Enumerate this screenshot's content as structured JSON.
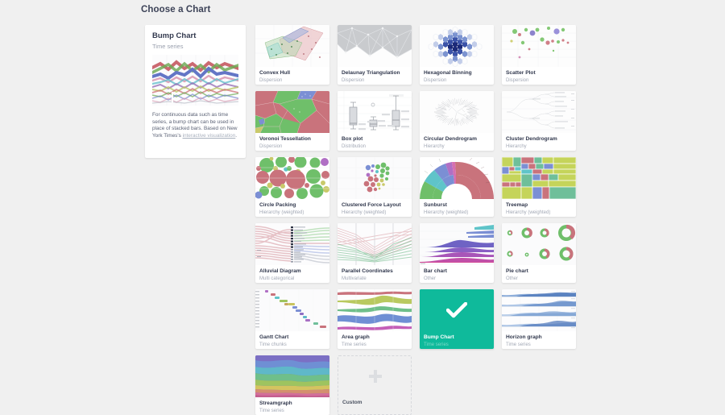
{
  "header": {
    "title": "Choose a Chart"
  },
  "detail": {
    "title": "Bump Chart",
    "subtitle": "Time series",
    "thumb_icon": "bump-chart-thumbnail",
    "description_pre": "For continuous data such as time series, a bump chart can be used in place of stacked bars. Based on New York Times's ",
    "description_link": "interactive visualization",
    "description_post": "."
  },
  "colors": {
    "page_background": "#f0f0f0",
    "card_background": "#ffffff",
    "title_text": "#32394e",
    "subtitle_text": "#a3a9b6",
    "selected_accent": "#0fba9b",
    "selected_subtitle": "#7fd9c9",
    "link": "#a8b0bd",
    "custom_border": "#d6d8dc"
  },
  "grid": {
    "cards": [
      {
        "title": "Convex Hull",
        "category": "Dispersion",
        "thumb": "convex-hull-thumbnail",
        "selected": false
      },
      {
        "title": "Delaunay Triangulation",
        "category": "Dispersion",
        "thumb": "delaunay-triangulation-thumbnail",
        "selected": false
      },
      {
        "title": "Hexagonal Binning",
        "category": "Dispersion",
        "thumb": "hexagonal-binning-thumbnail",
        "selected": false
      },
      {
        "title": "Scatter Plot",
        "category": "Dispersion",
        "thumb": "scatter-plot-thumbnail",
        "selected": false
      },
      {
        "title": "Voronoi Tessellation",
        "category": "Dispersion",
        "thumb": "voronoi-tessellation-thumbnail",
        "selected": false
      },
      {
        "title": "Box plot",
        "category": "Distribution",
        "thumb": "box-plot-thumbnail",
        "selected": false
      },
      {
        "title": "Circular Dendrogram",
        "category": "Hierarchy",
        "thumb": "circular-dendrogram-thumbnail",
        "selected": false
      },
      {
        "title": "Cluster Dendrogram",
        "category": "Hierarchy",
        "thumb": "cluster-dendrogram-thumbnail",
        "selected": false
      },
      {
        "title": "Circle Packing",
        "category": "Hierarchy (weighted)",
        "thumb": "circle-packing-thumbnail",
        "selected": false
      },
      {
        "title": "Clustered Force Layout",
        "category": "Hierarchy (weighted)",
        "thumb": "clustered-force-layout-thumbnail",
        "selected": false
      },
      {
        "title": "Sunburst",
        "category": "Hierarchy (weighted)",
        "thumb": "sunburst-thumbnail",
        "selected": false
      },
      {
        "title": "Treemap",
        "category": "Hierarchy (weighted)",
        "thumb": "treemap-thumbnail",
        "selected": false
      },
      {
        "title": "Alluvial Diagram",
        "category": "Multi categorical",
        "thumb": "alluvial-diagram-thumbnail",
        "selected": false
      },
      {
        "title": "Parallel Coordinates",
        "category": "Multivariate",
        "thumb": "parallel-coordinates-thumbnail",
        "selected": false
      },
      {
        "title": "Bar chart",
        "category": "Other",
        "thumb": "bar-chart-thumbnail",
        "selected": false
      },
      {
        "title": "Pie chart",
        "category": "Other",
        "thumb": "pie-chart-thumbnail",
        "selected": false
      },
      {
        "title": "Gantt Chart",
        "category": "Time chunks",
        "thumb": "gantt-chart-thumbnail",
        "selected": false
      },
      {
        "title": "Area graph",
        "category": "Time series",
        "thumb": "area-graph-thumbnail",
        "selected": false
      },
      {
        "title": "Bump Chart",
        "category": "Time series",
        "thumb": "checkmark-icon",
        "selected": true
      },
      {
        "title": "Horizon graph",
        "category": "Time series",
        "thumb": "horizon-graph-thumbnail",
        "selected": false
      },
      {
        "title": "Streamgraph",
        "category": "Time series",
        "thumb": "streamgraph-thumbnail",
        "selected": false
      },
      {
        "title": "Custom",
        "category": "",
        "thumb": "plus-icon",
        "selected": false,
        "custom": true
      }
    ]
  }
}
